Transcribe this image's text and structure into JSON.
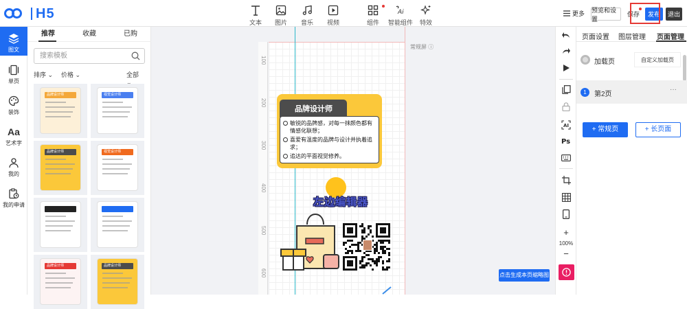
{
  "brand": {
    "name": "H5",
    "color": "#1f6cf2"
  },
  "toolbar": {
    "tools": [
      {
        "id": "text",
        "label": "文本",
        "icon": "text-icon"
      },
      {
        "id": "image",
        "label": "图片",
        "icon": "image-icon"
      },
      {
        "id": "music",
        "label": "音乐",
        "icon": "music-icon"
      },
      {
        "id": "video",
        "label": "视频",
        "icon": "video-icon"
      },
      {
        "id": "components",
        "label": "组件",
        "icon": "grid-icon"
      },
      {
        "id": "smart",
        "label": "智能组件",
        "icon": "ai-icon"
      },
      {
        "id": "effects",
        "label": "特效",
        "icon": "sparkle-icon"
      }
    ],
    "more_label": "更多",
    "preview_label": "预览和设置",
    "save_label": "保存",
    "publish_label": "发布",
    "exit_label": "退出"
  },
  "sidebar": {
    "items": [
      {
        "label": "图文",
        "icon": "layers-icon",
        "active": true
      },
      {
        "label": "单页",
        "icon": "page-icon"
      },
      {
        "label": "装饰",
        "icon": "palette-icon"
      },
      {
        "label": "艺术字",
        "icon": "font-icon",
        "glyph": "Aa"
      },
      {
        "label": "我的",
        "icon": "user-icon"
      },
      {
        "label": "我的申请",
        "icon": "clipboard-clock-icon"
      }
    ]
  },
  "templates": {
    "tabs": [
      {
        "label": "推荐",
        "active": true
      },
      {
        "label": "收藏"
      },
      {
        "label": "已购"
      }
    ],
    "search_placeholder": "搜索模板",
    "filters": {
      "sort": "排序",
      "price": "价格",
      "all": "全部"
    },
    "thumbs": [
      {
        "title": "品牌设计师",
        "tone": "#fdf0d8",
        "head": "#f4a83a"
      },
      {
        "title": "视觉设计师",
        "tone": "#ffffff",
        "head": "#4a7ff0"
      },
      {
        "title": "品牌设计师",
        "tone": "#fbc83a",
        "head": "#4c4c4c"
      },
      {
        "title": "视觉设计师",
        "tone": "#ffffff",
        "head": "#f06a1e"
      },
      {
        "title": "",
        "tone": "#ffffff",
        "head": "#222222"
      },
      {
        "title": "",
        "tone": "#ffffff",
        "head": "#1f6cf2"
      },
      {
        "title": "品牌设计师",
        "tone": "#fdf3f3",
        "head": "#e53935"
      },
      {
        "title": "品牌设计师",
        "tone": "#fbc83a",
        "head": "#4c4c4c"
      }
    ]
  },
  "canvas": {
    "ruler_marks": [
      "100",
      "200",
      "300",
      "400",
      "500",
      "600"
    ],
    "screen_label": "常规屏",
    "generate_thumb_label": "点击生成本页缩略图",
    "card": {
      "title": "品牌设计师",
      "bullets": [
        "敏锐的品牌感，对每一抹颜色都有情感化联想；",
        "喜爱有温度的品牌与设计并执着追求；",
        "追达的平面视觉修养。"
      ]
    },
    "editor_text": "左边编辑器"
  },
  "right_tools": {
    "zoom": "100%",
    "icons": [
      "undo-icon",
      "redo-icon",
      "play-icon",
      "copy-icon",
      "lock-icon",
      "ai-text-icon",
      "ps-icon",
      "keyboard-icon",
      "crop-icon",
      "table-icon",
      "phone-icon",
      "plus-icon",
      "minus-icon",
      "alert-icon"
    ]
  },
  "pages_panel": {
    "tabs": [
      {
        "label": "页面设置"
      },
      {
        "label": "图层管理"
      },
      {
        "label": "页面管理",
        "active": true
      }
    ],
    "loading_page": {
      "label": "加载页",
      "action": "自定义加载页"
    },
    "pages": [
      {
        "number": "1",
        "label": "第2页",
        "more": "···"
      }
    ],
    "add_normal": "+ 常规页",
    "add_long": "+ 长页面"
  }
}
